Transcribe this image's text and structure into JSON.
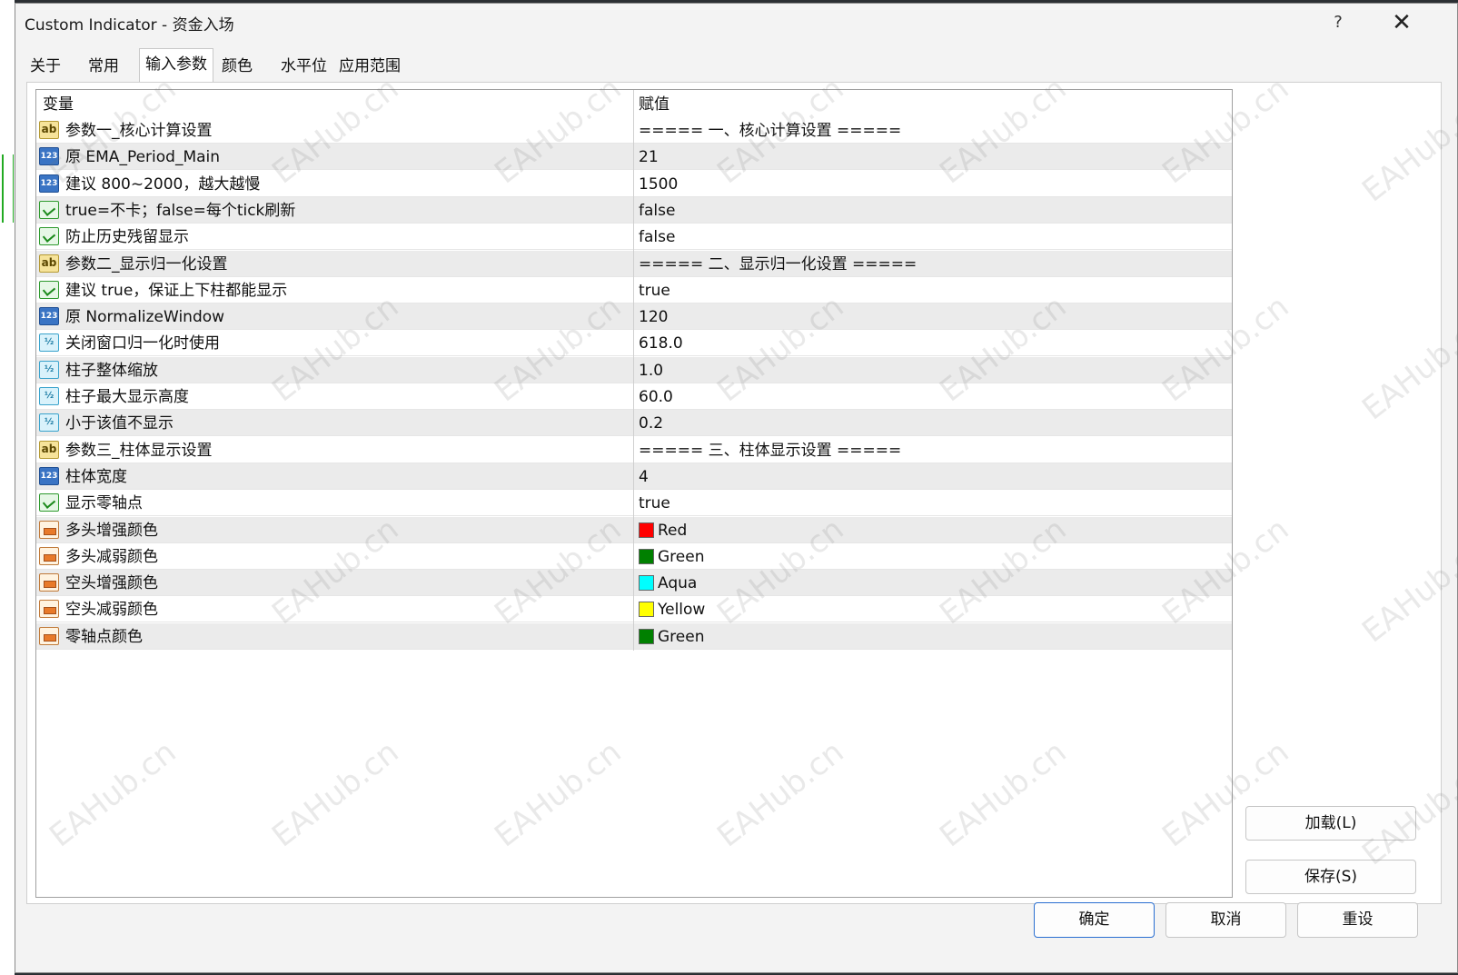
{
  "window": {
    "title": "Custom Indicator - 资金入场",
    "help_label": "?",
    "close_label": "✕"
  },
  "tabs": [
    {
      "label": "关于"
    },
    {
      "label": "常用"
    },
    {
      "label": "输入参数",
      "active": true
    },
    {
      "label": "颜色"
    },
    {
      "label": "水平位"
    },
    {
      "label": "应用范围"
    }
  ],
  "grid": {
    "header": {
      "variable": "变量",
      "value": "赋值"
    },
    "rows": [
      {
        "icon": "string-icon",
        "name": "参数一_核心计算设置",
        "value": "===== 一、核心计算设置 ====="
      },
      {
        "icon": "int-icon",
        "name": "原 EMA_Period_Main",
        "value": "21"
      },
      {
        "icon": "int-icon",
        "name": "建议 800~2000，越大越慢",
        "value": "1500"
      },
      {
        "icon": "bool-icon",
        "name": "true=不卡；false=每个tick刷新",
        "value": "false"
      },
      {
        "icon": "bool-icon",
        "name": "防止历史残留显示",
        "value": "false"
      },
      {
        "icon": "string-icon",
        "name": "参数二_显示归一化设置",
        "value": "===== 二、显示归一化设置 ====="
      },
      {
        "icon": "bool-icon",
        "name": "建议 true，保证上下柱都能显示",
        "value": "true"
      },
      {
        "icon": "int-icon",
        "name": "原 NormalizeWindow",
        "value": "120"
      },
      {
        "icon": "double-icon",
        "name": "关闭窗口归一化时使用",
        "value": "618.0"
      },
      {
        "icon": "double-icon",
        "name": "柱子整体缩放",
        "value": "1.0"
      },
      {
        "icon": "double-icon",
        "name": "柱子最大显示高度",
        "value": "60.0"
      },
      {
        "icon": "double-icon",
        "name": "小于该值不显示",
        "value": "0.2"
      },
      {
        "icon": "string-icon",
        "name": "参数三_柱体显示设置",
        "value": "===== 三、柱体显示设置 ====="
      },
      {
        "icon": "int-icon",
        "name": "柱体宽度",
        "value": "4"
      },
      {
        "icon": "bool-icon",
        "name": "显示零轴点",
        "value": "true"
      },
      {
        "icon": "color-icon",
        "name": "多头增强颜色",
        "value": "Red",
        "swatch": "#ff0000"
      },
      {
        "icon": "color-icon",
        "name": "多头减弱颜色",
        "value": "Green",
        "swatch": "#008000"
      },
      {
        "icon": "color-icon",
        "name": "空头增强颜色",
        "value": "Aqua",
        "swatch": "#00ffff"
      },
      {
        "icon": "color-icon",
        "name": "空头减弱颜色",
        "value": "Yellow",
        "swatch": "#ffff00"
      },
      {
        "icon": "color-icon",
        "name": "零轴点颜色",
        "value": "Green",
        "swatch": "#008000"
      }
    ]
  },
  "side_buttons": {
    "load": "加载(L)",
    "save": "保存(S)"
  },
  "bottom_buttons": {
    "ok": "确定",
    "cancel": "取消",
    "reset": "重设"
  },
  "watermark": "EAHub.cn",
  "colors": {
    "accent": "#2a6fd1",
    "row_alt": "#ebebeb"
  }
}
